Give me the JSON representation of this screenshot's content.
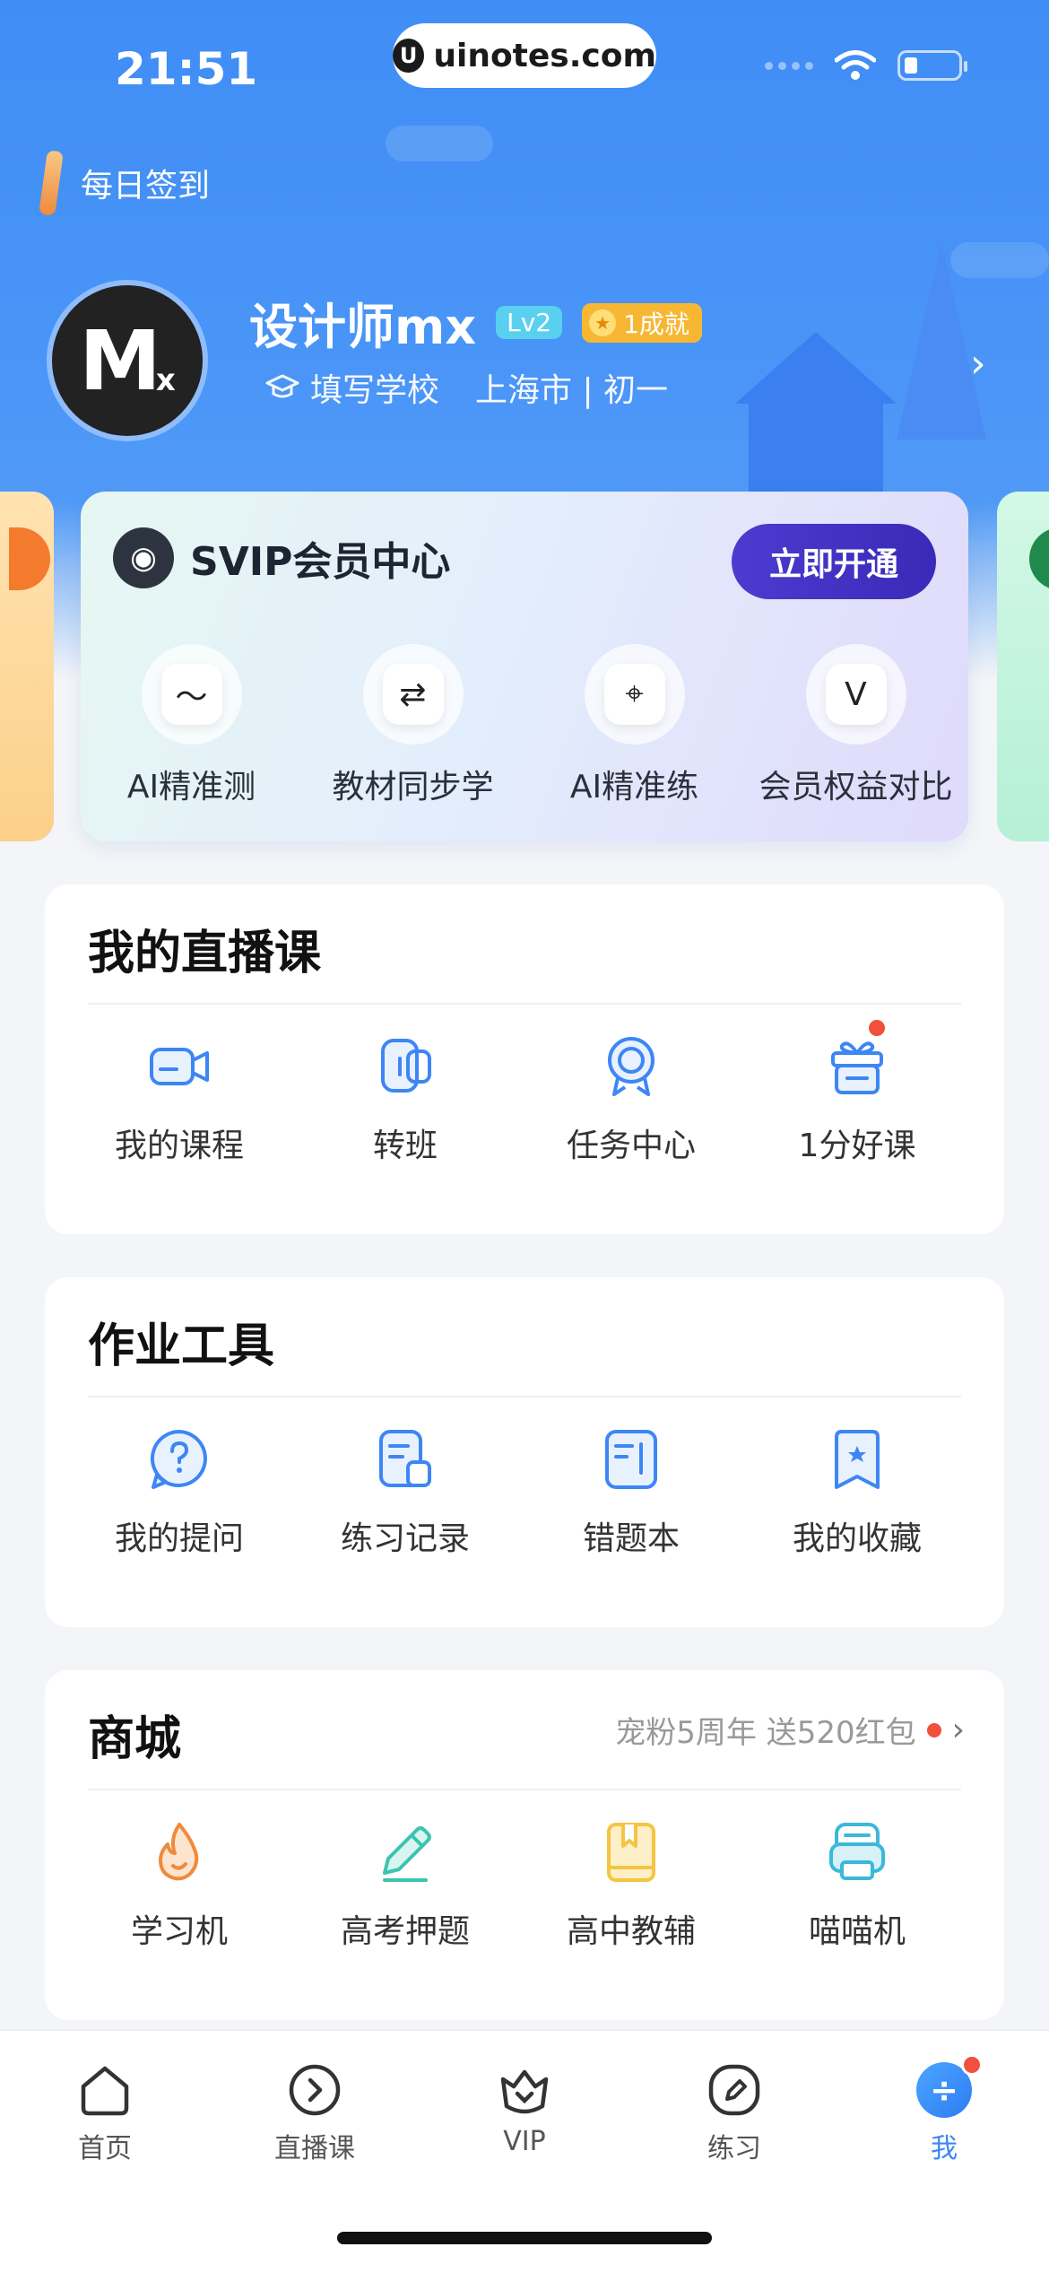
{
  "status_bar": {
    "time": "21:51",
    "url": "uinotes.com"
  },
  "checkin": {
    "label": "每日签到"
  },
  "profile": {
    "username": "设计师mx",
    "level": "Lv2",
    "achievement": "1成就",
    "school": "填写学校",
    "location": "上海市 | 初一"
  },
  "vip": {
    "title": "SVIP会员中心",
    "cta": "立即开通",
    "features": [
      {
        "label": "AI精准测",
        "icon": "ai-test-icon"
      },
      {
        "label": "教材同步学",
        "icon": "textbook-sync-icon"
      },
      {
        "label": "AI精准练",
        "icon": "ai-practice-icon"
      },
      {
        "label": "会员权益对比",
        "icon": "vip-compare-icon"
      }
    ]
  },
  "live_courses": {
    "title": "我的直播课",
    "items": [
      {
        "label": "我的课程",
        "icon": "video-camera-icon"
      },
      {
        "label": "转班",
        "icon": "transfer-class-icon"
      },
      {
        "label": "任务中心",
        "icon": "medal-icon"
      },
      {
        "label": "1分好课",
        "icon": "gift-icon",
        "badge": true
      }
    ]
  },
  "homework_tools": {
    "title": "作业工具",
    "items": [
      {
        "label": "我的提问",
        "icon": "question-bubble-icon"
      },
      {
        "label": "练习记录",
        "icon": "practice-record-icon"
      },
      {
        "label": "错题本",
        "icon": "mistake-book-icon"
      },
      {
        "label": "我的收藏",
        "icon": "bookmark-icon"
      }
    ]
  },
  "shop": {
    "title": "商城",
    "promo": "宠粉5周年 送520红包",
    "items": [
      {
        "label": "学习机",
        "icon": "flame-icon"
      },
      {
        "label": "高考押题",
        "icon": "pencil-icon"
      },
      {
        "label": "高中教辅",
        "icon": "book-icon"
      },
      {
        "label": "喵喵机",
        "icon": "printer-icon"
      }
    ]
  },
  "tabbar": {
    "tabs": [
      {
        "label": "首页",
        "icon": "home-icon"
      },
      {
        "label": "直播课",
        "icon": "play-circle-icon"
      },
      {
        "label": "VIP",
        "icon": "crown-icon"
      },
      {
        "label": "练习",
        "icon": "edit-icon"
      },
      {
        "label": "我",
        "icon": "me-icon",
        "active": true
      }
    ]
  },
  "colors": {
    "brand_blue": "#3d86f5",
    "vip_button": "#4c3bd0",
    "badge_red": "#f0503c",
    "shop_orange": "#f08a3c",
    "shop_teal": "#3cc4b0",
    "shop_yellow": "#f5c542"
  }
}
